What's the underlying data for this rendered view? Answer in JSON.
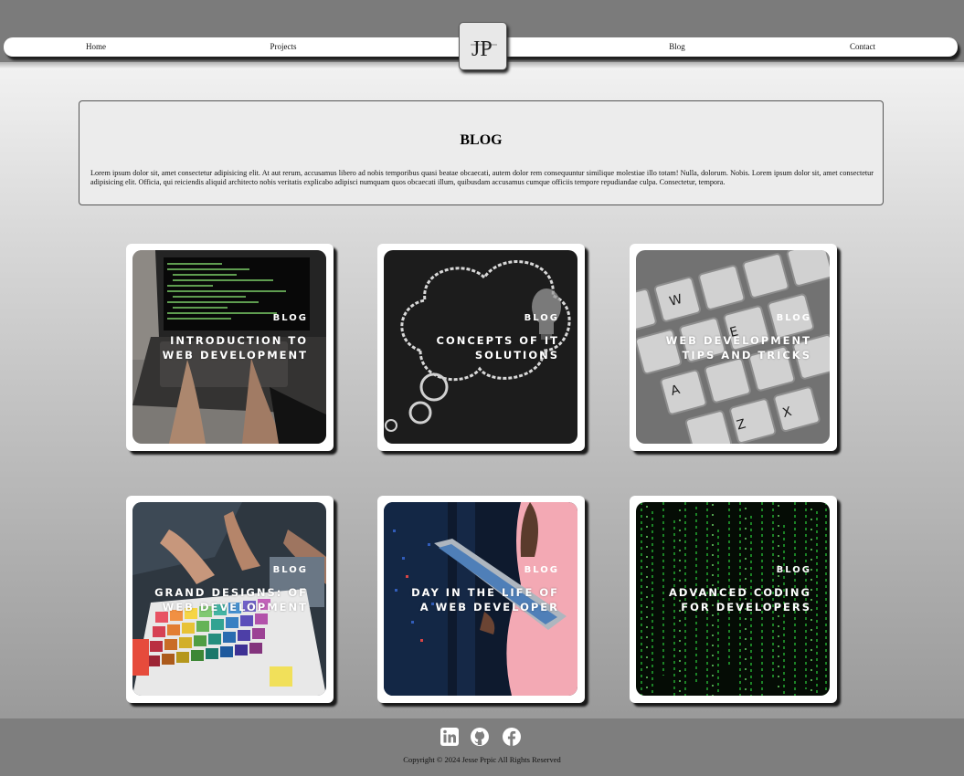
{
  "nav": {
    "links": [
      "Home",
      "Projects",
      "Blog",
      "Contact"
    ],
    "logo": "JP"
  },
  "intro": {
    "heading": "BLOG",
    "text": "Lorem ipsum dolor sit, amet consectetur adipisicing elit. At aut rerum, accusamus libero ad nobis temporibus quasi beatae obcaecati, autem dolor rem consequuntur similique molestiae illo totam! Nulla, dolorum. Nobis. Lorem ipsum dolor sit, amet consectetur adipisicing elit. Officia, qui reiciendis aliquid architecto nobis veritatis explicabo adipisci numquam quos obcaecati illum, quibusdam accusamus cumque officiis tempore repudiandae culpa. Consectetur, tempora."
  },
  "posts": [
    {
      "tag": "BLOG",
      "title_line1": "INTRODUCTION TO",
      "title_line2": "WEB DEVELOPMENT",
      "image": "laptop-typing"
    },
    {
      "tag": "BLOG",
      "title_line1": "CONCEPTS OF IT",
      "title_line2": "SOLUTIONS",
      "image": "chalk-lightbulb"
    },
    {
      "tag": "BLOG",
      "title_line1": "WEB DEVELOPMENT",
      "title_line2": "TIPS AND TRICKS",
      "image": "keyboard-keys"
    },
    {
      "tag": "BLOG",
      "title_line1": "GRAND DESIGNS: OF",
      "title_line2": "WEB DEVELOPMENT",
      "image": "color-swatches"
    },
    {
      "tag": "BLOG",
      "title_line1": "DAY IN THE LIFE OF",
      "title_line2": "A WEB DEVELOPER",
      "image": "server-room-tablet"
    },
    {
      "tag": "BLOG",
      "title_line1": "ADVANCED CODING",
      "title_line2": "FOR DEVELOPERS",
      "image": "matrix-code"
    }
  ],
  "footer": {
    "icons": [
      "linkedin-icon",
      "github-icon",
      "facebook-icon"
    ],
    "copyright": "Copyright © 2024 Jesse Prpic All Rights Reserved"
  }
}
